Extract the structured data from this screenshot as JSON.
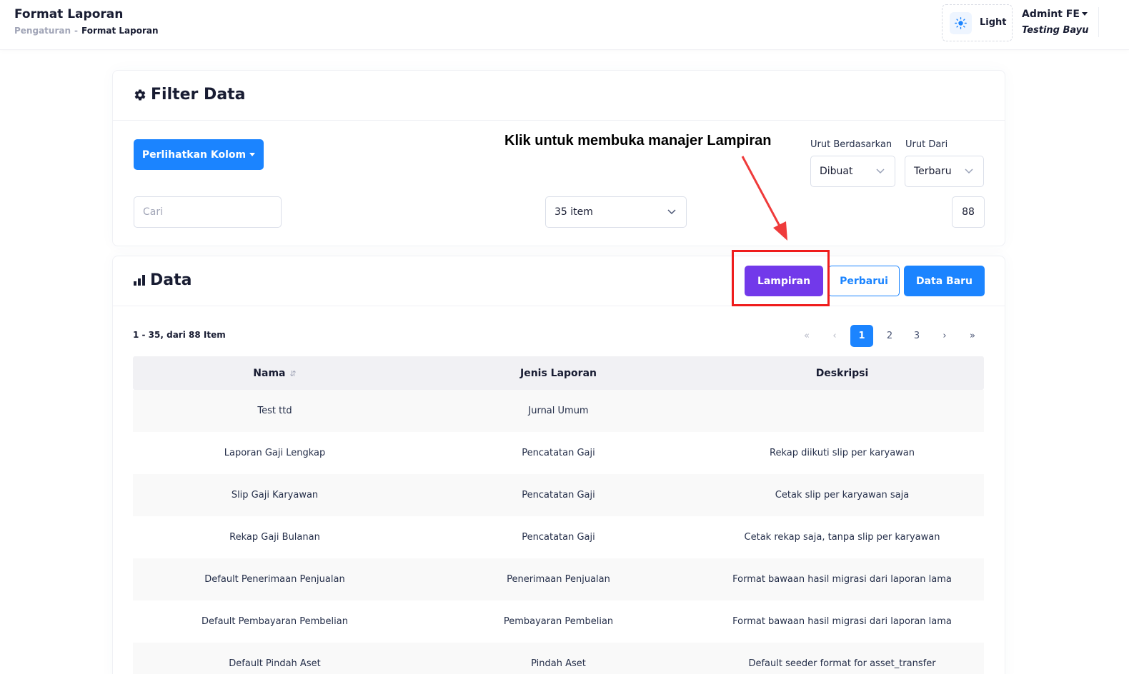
{
  "header": {
    "title": "Format Laporan",
    "breadcrumb": [
      "Pengaturan",
      "-",
      "Format Laporan"
    ],
    "theme": {
      "icon": "sun-icon",
      "label": "Light"
    },
    "user": {
      "name": "Admint FE",
      "subtitle": "Testing Bayu"
    }
  },
  "filter": {
    "title": "Filter Data",
    "title_icon": "gear-icon",
    "columns_button": "Perlihatkan Kolom",
    "search_placeholder": "Cari",
    "per_page": "35 item",
    "sort_by": {
      "label": "Urut Berdasarkan",
      "value": "Dibuat"
    },
    "sort_order": {
      "label": "Urut Dari",
      "value": "Terbaru"
    },
    "total": "88"
  },
  "annotation": {
    "text": "Klik untuk membuka manajer Lampiran",
    "color": "#ef1c1c"
  },
  "data": {
    "title": "Data",
    "title_icon": "bar-chart-icon",
    "buttons": {
      "attachments": "Lampiran",
      "refresh": "Perbarui",
      "new": "Data Baru"
    },
    "range_text": "1 - 35, dari 88 Item",
    "pagination": {
      "first": "«",
      "prev": "‹",
      "pages": [
        "1",
        "2",
        "3"
      ],
      "active": "1",
      "next": "›",
      "last": "»"
    },
    "columns": [
      "Nama",
      "Jenis Laporan",
      "Deskripsi"
    ],
    "sort_icon": "sort-icon",
    "rows": [
      [
        "Test ttd",
        "Jurnal Umum",
        ""
      ],
      [
        "Laporan Gaji Lengkap",
        "Pencatatan Gaji",
        "Rekap diikuti slip per karyawan"
      ],
      [
        "Slip Gaji Karyawan",
        "Pencatatan Gaji",
        "Cetak slip per karyawan saja"
      ],
      [
        "Rekap Gaji Bulanan",
        "Pencatatan Gaji",
        "Cetak rekap saja, tanpa slip per karyawan"
      ],
      [
        "Default Penerimaan Penjualan",
        "Penerimaan Penjualan",
        "Format bawaan hasil migrasi dari laporan lama"
      ],
      [
        "Default Pembayaran Pembelian",
        "Pembayaran Pembelian",
        "Format bawaan hasil migrasi dari laporan lama"
      ],
      [
        "Default Pindah Aset",
        "Pindah Aset",
        "Default seeder format for asset_transfer"
      ]
    ]
  },
  "colors": {
    "primary": "#1b84ff",
    "purple": "#7239ea",
    "annotation_red": "#ef1c1c",
    "text_dark": "#181c32",
    "muted": "#a1a5b7"
  }
}
